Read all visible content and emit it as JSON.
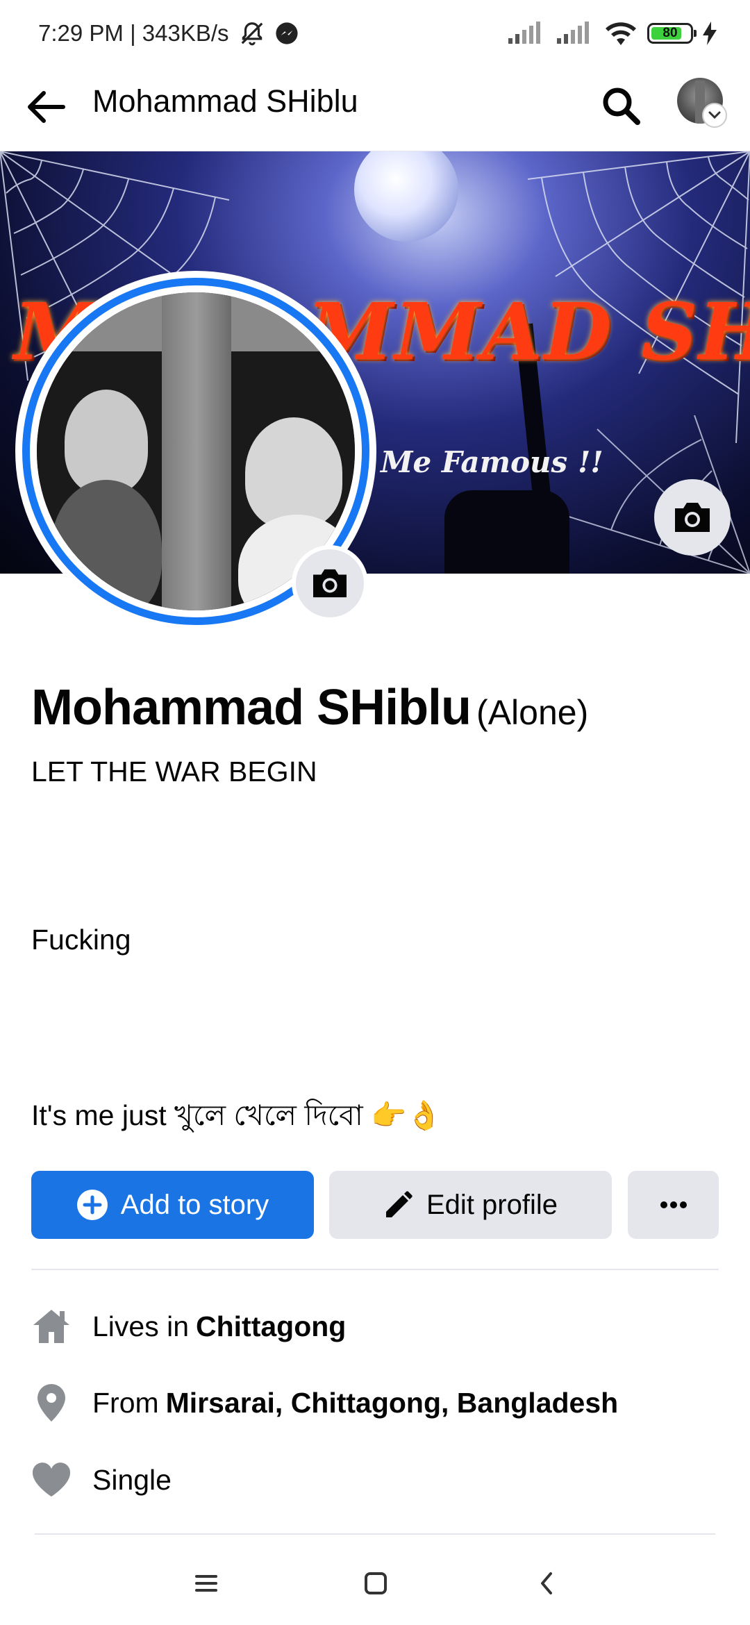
{
  "status_bar": {
    "time_speed": "7:29 PM | 343KB/s",
    "battery_level": "80",
    "battery_fraction": 0.8,
    "icons": [
      "mute-bell-icon",
      "messenger-icon",
      "signal-icon",
      "signal-icon",
      "wifi-icon",
      "battery-icon",
      "charging-icon"
    ]
  },
  "header": {
    "title": "Mohammad SHiblu",
    "icons": [
      "back-arrow-icon",
      "search-icon",
      "chevron-down-icon"
    ]
  },
  "cover": {
    "title": "MOHAMMAD SHIBLU",
    "subtitle": "Me Famous !!"
  },
  "profile": {
    "name": "Mohammad SHiblu",
    "alternate_name": "(Alone)",
    "bio": {
      "line1": "LET THE WAR BEGIN",
      "line2": "Fucking",
      "line3": "It's me just খুলে খেলে দিবো 👉👌"
    }
  },
  "actions": {
    "add_story": "Add to story",
    "edit_profile": "Edit profile",
    "more": "•••"
  },
  "details": [
    {
      "icon": "home-icon",
      "prefix": "Lives in",
      "value": "Chittagong"
    },
    {
      "icon": "location-pin-icon",
      "prefix": "From",
      "value": "Mirsarai, Chittagong, Bangladesh"
    },
    {
      "icon": "heart-icon",
      "prefix": "Single",
      "value": ""
    }
  ],
  "colors": {
    "accent": "#1b74e4",
    "button_gray": "#e4e6eb",
    "icon_gray": "#8a8d91",
    "text": "#050505"
  }
}
